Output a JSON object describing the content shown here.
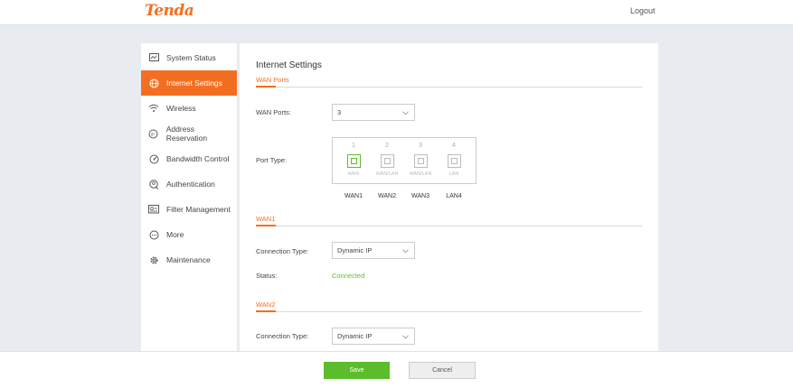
{
  "header": {
    "logo": "Tenda",
    "logout": "Logout"
  },
  "sidebar": {
    "items": [
      {
        "label": "System Status",
        "icon": "monitor-icon"
      },
      {
        "label": "Internet Settings",
        "icon": "globe-icon",
        "active": true
      },
      {
        "label": "Wireless",
        "icon": "wifi-icon"
      },
      {
        "label": "Address Reservation",
        "icon": "ip-icon"
      },
      {
        "label": "Bandwidth Control",
        "icon": "gauge-icon"
      },
      {
        "label": "Authentication",
        "icon": "auth-icon"
      },
      {
        "label": "Filter Management",
        "icon": "filter-icon"
      },
      {
        "label": "More",
        "icon": "more-icon"
      },
      {
        "label": "Maintenance",
        "icon": "gear-icon"
      }
    ]
  },
  "main": {
    "title": "Internet Settings",
    "wan_ports_section": {
      "title": "WAN Ports",
      "wan_ports_label": "WAN Ports:",
      "wan_ports_value": "3",
      "port_type_label": "Port Type:",
      "ports": [
        {
          "number": "1",
          "role": "WAN",
          "name": "WAN1",
          "active": true
        },
        {
          "number": "2",
          "role": "WAN/LAN",
          "name": "WAN2",
          "active": false
        },
        {
          "number": "3",
          "role": "WAN/LAN",
          "name": "WAN3",
          "active": false
        },
        {
          "number": "4",
          "role": "LAN",
          "name": "LAN4",
          "active": false
        }
      ]
    },
    "wan1": {
      "title": "WAN1",
      "connection_type_label": "Connection Type:",
      "connection_type_value": "Dynamic IP",
      "status_label": "Status:",
      "status_value": "Connected"
    },
    "wan2": {
      "title": "WAN2",
      "connection_type_label": "Connection Type:",
      "connection_type_value": "Dynamic IP"
    }
  },
  "footer": {
    "save": "Save",
    "cancel": "Cancel"
  },
  "colors": {
    "accent": "#f26f21",
    "success": "#5bbd2b",
    "background": "#e8ebf0"
  }
}
